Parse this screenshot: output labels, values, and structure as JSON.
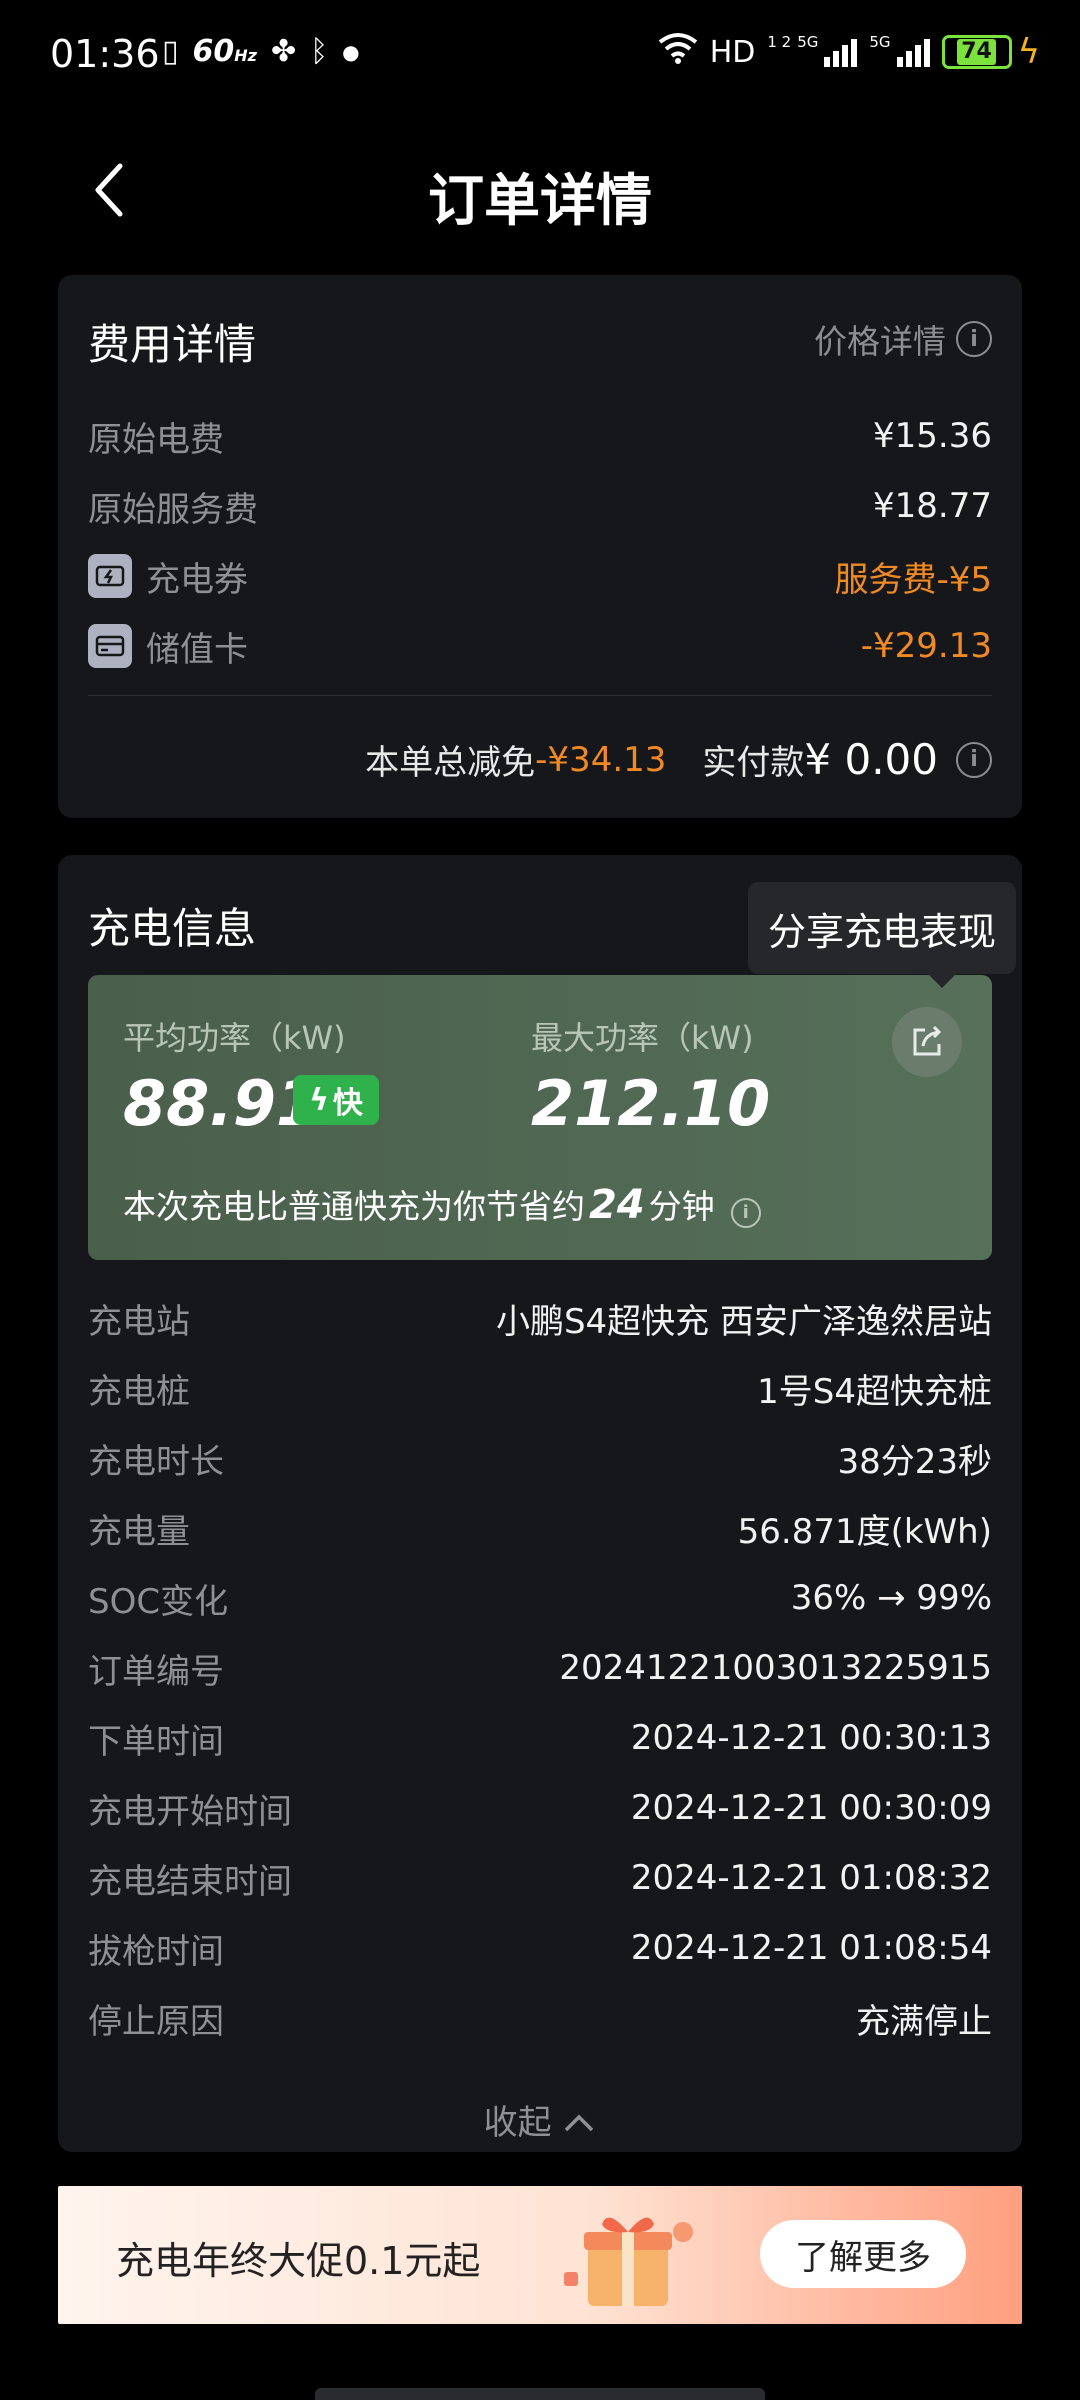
{
  "status_bar": {
    "time": "01:36",
    "refresh": "60",
    "refresh_unit": "Hz",
    "network": "HD",
    "network_sub": "1 2",
    "sim1": "5G",
    "sim2": "5G",
    "battery": "74",
    "accent": "#7ce33c"
  },
  "header": {
    "title": "订单详情",
    "back_icon": "chevron-left-icon"
  },
  "fee": {
    "title": "费用详情",
    "price_detail": "价格详情",
    "rows": [
      {
        "label": "原始电费",
        "value": "¥15.36"
      },
      {
        "label": "原始服务费",
        "value": "¥18.77"
      },
      {
        "label": "充电券",
        "value": "服务费-¥5",
        "icon": "coupon-icon"
      },
      {
        "label": "储值卡",
        "value": "-¥29.13",
        "icon": "card-icon"
      }
    ],
    "total_discount_label": "本单总减免",
    "total_discount": "-¥34.13",
    "paid_label": "实付款",
    "paid": "¥ 0.00",
    "discount_color": "#f08a24"
  },
  "charge": {
    "title": "充电信息",
    "share_tooltip": "分享充电表现",
    "avg_power_label": "平均功率（kW)",
    "avg_power": "88.91",
    "fast_badge": "快",
    "max_power_label": "最大功率（kW)",
    "max_power": "212.10",
    "saving_prefix": "本次充电比普通快充为你节省约",
    "saving_minutes": "24",
    "saving_suffix": "分钟",
    "rows": [
      {
        "label": "充电站",
        "value": "小鹏S4超快充 西安广泽逸然居站"
      },
      {
        "label": "充电桩",
        "value": "1号S4超快充桩"
      },
      {
        "label": "充电时长",
        "value": "38分23秒"
      },
      {
        "label": "充电量",
        "value": "56.871度(kWh)"
      },
      {
        "label": "SOC变化",
        "value": "36% → 99%"
      },
      {
        "label": "订单编号",
        "value": "20241221003013225915"
      },
      {
        "label": "下单时间",
        "value": "2024-12-21 00:30:13"
      },
      {
        "label": "充电开始时间",
        "value": "2024-12-21 00:30:09"
      },
      {
        "label": "充电结束时间",
        "value": "2024-12-21 01:08:32"
      },
      {
        "label": "拔枪时间",
        "value": "2024-12-21 01:08:54"
      },
      {
        "label": "停止原因",
        "value": "充满停止"
      }
    ],
    "collapse": "收起"
  },
  "banner": {
    "text": "充电年终大促0.1元起",
    "button": "了解更多"
  }
}
